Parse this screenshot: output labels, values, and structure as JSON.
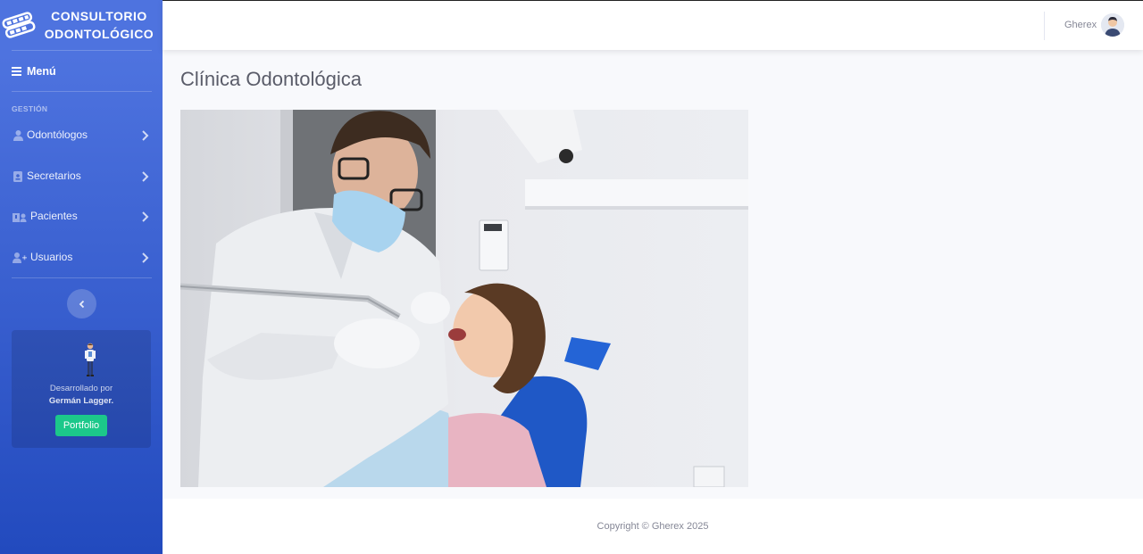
{
  "brand": {
    "line1": "CONSULTORIO",
    "line2": "ODONTOLÓGICO",
    "icon": "tooth-brace-icon"
  },
  "sidebar": {
    "menu_label": "Menú",
    "section_heading": "GESTIÓN",
    "items": [
      {
        "label": "Odontólogos",
        "icon": "user-icon"
      },
      {
        "label": "Secretarios",
        "icon": "id-badge-icon"
      },
      {
        "label": "Pacientes",
        "icon": "hospital-user-icon"
      },
      {
        "label": "Usuarios",
        "icon": "user-plus-icon"
      }
    ],
    "card": {
      "line1": "Desarrollado por",
      "line2": "Germán Lagger.",
      "button": "Portfolio"
    }
  },
  "topbar": {
    "username": "Gherex"
  },
  "main": {
    "title": "Clínica Odontológica"
  },
  "footer": {
    "copyright": "Copyright © Gherex 2025"
  },
  "colors": {
    "sidebar_top": "#4e73df",
    "sidebar_bottom": "#224abe",
    "success": "#1cc88a"
  }
}
